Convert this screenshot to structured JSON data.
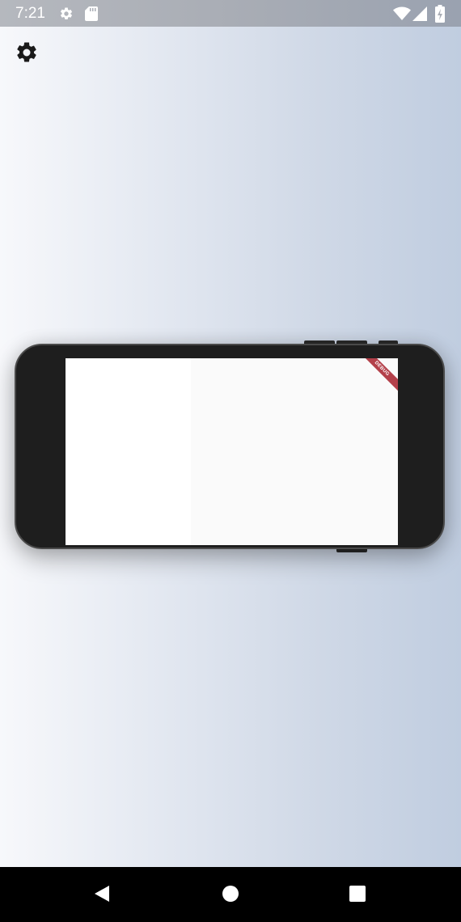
{
  "status_bar": {
    "time": "7:21",
    "icons": [
      "settings-icon",
      "sd-card-icon",
      "wifi-icon",
      "signal-icon",
      "battery-charging-icon"
    ]
  },
  "toolbar": {
    "settings_icon": "gear-icon"
  },
  "device_preview": {
    "orientation": "landscape",
    "debug_banner": "DEBUG",
    "banner_color": "#b3404a",
    "frame_color": "#1e1e1e"
  },
  "nav_bar": {
    "buttons": [
      "back-icon",
      "home-icon",
      "recents-icon"
    ]
  },
  "colors": {
    "background_start": "#f7f8fb",
    "background_end": "#c0cde0",
    "status_bar": "#a9adb5",
    "nav_bar": "#000000"
  }
}
